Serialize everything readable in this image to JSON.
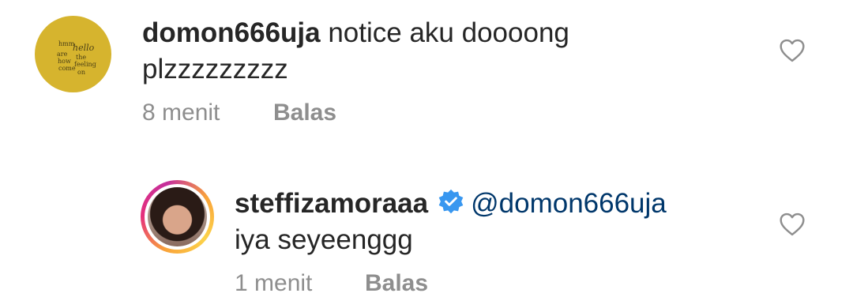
{
  "comments": [
    {
      "username": "domon666uja",
      "text_line1": "notice aku doooong",
      "text_line2": "plzzzzzzzzz",
      "time": "8 menit",
      "reply_label": "Balas",
      "avatar_text": [
        "hmm",
        "hello",
        "are",
        "the",
        "how",
        "feeling",
        "come",
        "on"
      ]
    },
    {
      "username": "steffizamoraaa",
      "verified": true,
      "mention": "@domon666uja",
      "text": "iya seyeenggg",
      "time": "1 menit",
      "reply_label": "Balas"
    }
  ],
  "colors": {
    "text": "#262626",
    "meta": "#8e8e8e",
    "mention": "#00376b",
    "verified": "#3897f0"
  }
}
